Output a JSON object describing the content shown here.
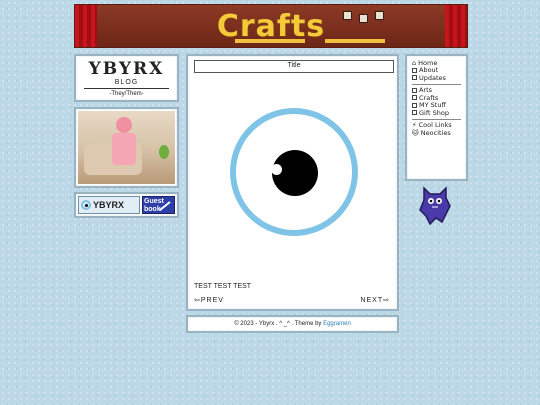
{
  "banner": {
    "title": "Crafts"
  },
  "logo": {
    "name": "YBYRX",
    "sub": "BLOG",
    "pronouns": "-They/Them-"
  },
  "badges": {
    "ybyrx": "YBYRX",
    "guestbook_line1": "Guest",
    "guestbook_line2": "book"
  },
  "main": {
    "title": "Title",
    "body_text": "TEST TEST TEST",
    "prev_label": "PREV",
    "next_label": "NEXT"
  },
  "footer": {
    "prefix": "© 2023 - Ybyrx . ^ _^ . Theme by ",
    "link": "Eggramen"
  },
  "nav": {
    "home": "Home",
    "about": "About",
    "updates": "Updates",
    "arts": "Arts",
    "crafts": "Crafts",
    "my_stuff": "MY Stuff",
    "gift_shop": "Gift Shop",
    "cool_links": "Cool Links",
    "neocities": "Neocities"
  },
  "colors": {
    "accent": "#7fc4e6",
    "banner_text": "#f4c93a",
    "link": "#2a7fb8"
  }
}
